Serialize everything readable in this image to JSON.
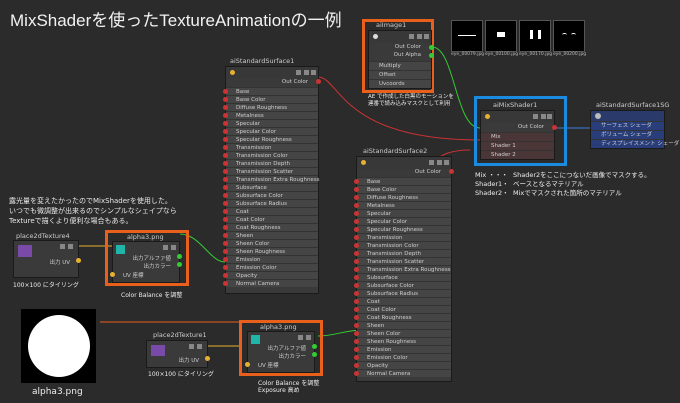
{
  "title": "MixShaderを使ったTextureAnimationの一例",
  "note_left": [
    "露光量を変えたかったのでMixShaderを使用した。",
    "いつでも微調整が出来るのでシンプルなシェイプなら",
    "Textureで描くより便利な場合もある。"
  ],
  "note_ae": [
    "AE で作成した白黒のモーションを",
    "連番で読み込みマスクとして利用"
  ],
  "note_mix": {
    "line1_key": "Mix ・・・",
    "line1_val": "Shader2をここにつないだ画像でマスクする。",
    "line2_key": "Shader1・",
    "line2_val": "ベースとなるマテリアル",
    "line3_key": "Shader2・",
    "line3_val": "Mixでマスクされた箇所のマテリアル"
  },
  "thumbs": [
    "eye_00079.jpg",
    "eye_00100.jpg",
    "eye_00170.jpg",
    "eye_00200.jpg"
  ],
  "aiImage1": {
    "title": "aiImage1",
    "out_color": "Out Color",
    "out_alpha": "Out Alpha",
    "rows": [
      "Multiply",
      "Offset",
      "Uvcoords"
    ]
  },
  "aiMixShader1": {
    "title": "aiMixShader1",
    "out_color": "Out Color",
    "rows": [
      "Mix",
      "Shader 1",
      "Shader 2"
    ]
  },
  "aiStandardSurface1SG": {
    "title": "aiStandardSurface1SG",
    "rows": [
      "サーフェス シェーダ",
      "ボリューム シェーダ",
      "ディスプレイスメント シェーダ"
    ]
  },
  "aiStandardSurface1": {
    "title": "aiStandardSurface1",
    "out_color": "Out Color",
    "rows": [
      "Base",
      "Base Color",
      "Diffuse Roughness",
      "Metalness",
      "Specular",
      "Specular Color",
      "Specular Roughness",
      "Transmission",
      "Transmission Color",
      "Transmission Depth",
      "Transmission Scatter",
      "Transmission Extra Roughness",
      "Subsurface",
      "Subsurface Color",
      "Subsurface Radius",
      "Coat",
      "Coat Color",
      "Coat Roughness",
      "Sheen",
      "Sheen Color",
      "Sheen Roughness",
      "Emission",
      "Emission Color",
      "Opacity",
      "Normal Camera"
    ]
  },
  "aiStandardSurface2": {
    "title": "aiStandardSurface2",
    "out_color": "Out Color",
    "rows": [
      "Base",
      "Base Color",
      "Diffuse Roughness",
      "Metalness",
      "Specular",
      "Specular Color",
      "Specular Roughness",
      "Transmission",
      "Transmission Color",
      "Transmission Depth",
      "Transmission Scatter",
      "Transmission Extra Roughness",
      "Subsurface",
      "Subsurface Color",
      "Subsurface Radius",
      "Coat",
      "Coat Color",
      "Coat Roughness",
      "Sheen",
      "Sheen Color",
      "Sheen Roughness",
      "Emission",
      "Emission Color",
      "Opacity",
      "Normal Camera"
    ]
  },
  "place2dTexture4": {
    "title": "place2dTexture4",
    "out_uv": "出力 UV",
    "caption": "100×100 にタイリング"
  },
  "place2dTexture1": {
    "title": "place2dTexture1",
    "out_uv": "出力 UV",
    "caption": "100×100 にタイリング"
  },
  "alpha3_top": {
    "title": "alpha3.png",
    "rows": [
      "出力アルファ値",
      "出力カラー",
      "UV 座標"
    ],
    "caption": "Color Balance を調整"
  },
  "alpha3_bottom": {
    "title": "alpha3.png",
    "rows": [
      "出力アルファ値",
      "出力カラー",
      "UV 座標"
    ],
    "caption1": "Color Balance を調整",
    "caption2": "Exposure 高め"
  },
  "alpha_preview_label": "alpha3.png",
  "colors": {
    "accent_orange": "#e8601c",
    "accent_blue": "#1b8be0",
    "bg": "#2b2b2b"
  }
}
